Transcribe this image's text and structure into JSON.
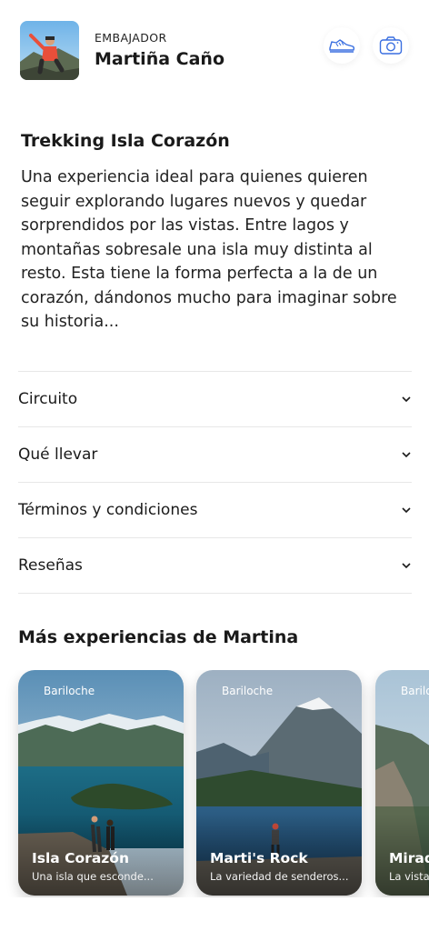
{
  "header": {
    "role_label": "EMBAJADOR",
    "name": "Martiña Caño",
    "shoe_icon": "sneaker-icon",
    "camera_icon": "camera-icon",
    "accent": "#3a6fe0"
  },
  "experience": {
    "title": "Trekking Isla Corazón",
    "description": "Una experiencia ideal para quienes quieren seguir explorando lugares nuevos y quedar sorprendidos por las vistas. Entre lagos y montañas sobresale una isla muy distinta al resto. Esta tiene la forma perfecta a la de un corazón, dándonos mucho para imaginar sobre su historia..."
  },
  "accordion": [
    {
      "label": "Circuito"
    },
    {
      "label": "Qué llevar"
    },
    {
      "label": "Términos y condiciones"
    },
    {
      "label": "Reseñas"
    }
  ],
  "more": {
    "title": "Más experiencias de Martina",
    "cards": [
      {
        "location": "Bariloche",
        "title": "Isla Corazón",
        "subtitle": "Una isla que esconde..."
      },
      {
        "location": "Bariloche",
        "title": "Marti's Rock",
        "subtitle": "La variedad de senderos..."
      },
      {
        "location": "Bariloche",
        "title": "Mirador",
        "subtitle": "La vista..."
      }
    ]
  }
}
